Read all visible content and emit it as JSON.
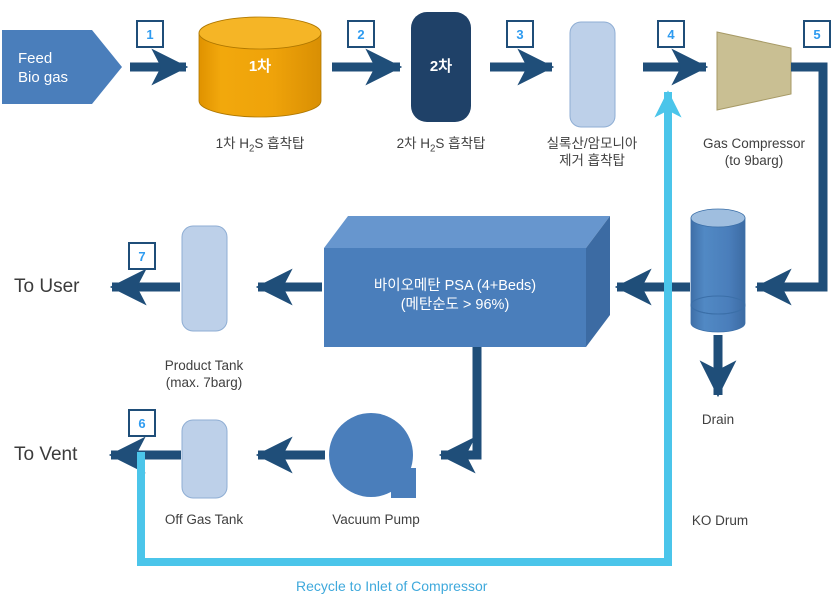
{
  "diagram": {
    "title": "Biogas Upgrading PSA Process Flow Diagram",
    "colors": {
      "feed_blue": "#4a7ebb",
      "adsorber1_orange": "#ED9F0D",
      "adsorber2_navy": "#1F4168",
      "tank_light_blue": "#BDD0E9",
      "compressor_tan": "#C9BF93",
      "psa_blue": "#4a7ebb",
      "arrow_navy": "#1F4E79",
      "recycle_cyan": "#4BC5EA",
      "numbox_border": "#1F4E79",
      "numbox_text": "#2E9BF0",
      "label_gray": "#404040"
    },
    "feed": {
      "line1": "Feed",
      "line2": "Bio gas"
    },
    "stream_numbers": [
      {
        "id": "1",
        "label": "1"
      },
      {
        "id": "2",
        "label": "2"
      },
      {
        "id": "3",
        "label": "3"
      },
      {
        "id": "4",
        "label": "4"
      },
      {
        "id": "5",
        "label": "5"
      },
      {
        "id": "6",
        "label": "6"
      },
      {
        "id": "7",
        "label": "7"
      }
    ],
    "equipment": [
      {
        "id": "adsorber-1",
        "inner_text": "1차",
        "caption": "1차 H2S 흡착탑",
        "caption_line1": "1차 H2S 흡착탑",
        "caption_line2": ""
      },
      {
        "id": "adsorber-2",
        "inner_text": "2차",
        "caption": "2차 H2S 흡착탑",
        "caption_line1": "2차 H2S 흡착탑",
        "caption_line2": ""
      },
      {
        "id": "siloxane-ammonia-adsorber",
        "inner_text": "",
        "caption": "실록산/암모니아 제거 흡착탑",
        "caption_line1": "실록산/암모니아",
        "caption_line2": "제거 흡착탑"
      },
      {
        "id": "gas-compressor",
        "inner_text": "",
        "caption": "Gas Compressor (to 9barg)",
        "caption_line1": "Gas Compressor",
        "caption_line2": "(to 9barg)"
      },
      {
        "id": "ko-drum",
        "inner_text": "",
        "caption": "KO Drum",
        "caption_line1": "KO Drum",
        "caption_line2": ""
      },
      {
        "id": "psa-unit",
        "inner_text": "바이오메탄 PSA (4+Beds)",
        "inner_text_line1": "바이오메탄 PSA (4+Beds)",
        "inner_text_line2": "(메탄순도 > 96%)",
        "caption": "",
        "caption_line1": "",
        "caption_line2": ""
      },
      {
        "id": "product-tank",
        "inner_text": "",
        "caption": "Product Tank (max. 7barg)",
        "caption_line1": "Product Tank",
        "caption_line2": "(max. 7barg)"
      },
      {
        "id": "off-gas-tank",
        "inner_text": "",
        "caption": "Off Gas Tank",
        "caption_line1": "Off Gas Tank",
        "caption_line2": ""
      },
      {
        "id": "vacuum-pump",
        "inner_text": "",
        "caption": "Vacuum Pump",
        "caption_line1": "Vacuum Pump",
        "caption_line2": ""
      }
    ],
    "terminals": [
      {
        "id": "to-user",
        "label": "To User"
      },
      {
        "id": "to-vent",
        "label": "To Vent"
      },
      {
        "id": "drain",
        "label": "Drain"
      }
    ],
    "recycle_caption": "Recycle to Inlet of Compressor"
  }
}
